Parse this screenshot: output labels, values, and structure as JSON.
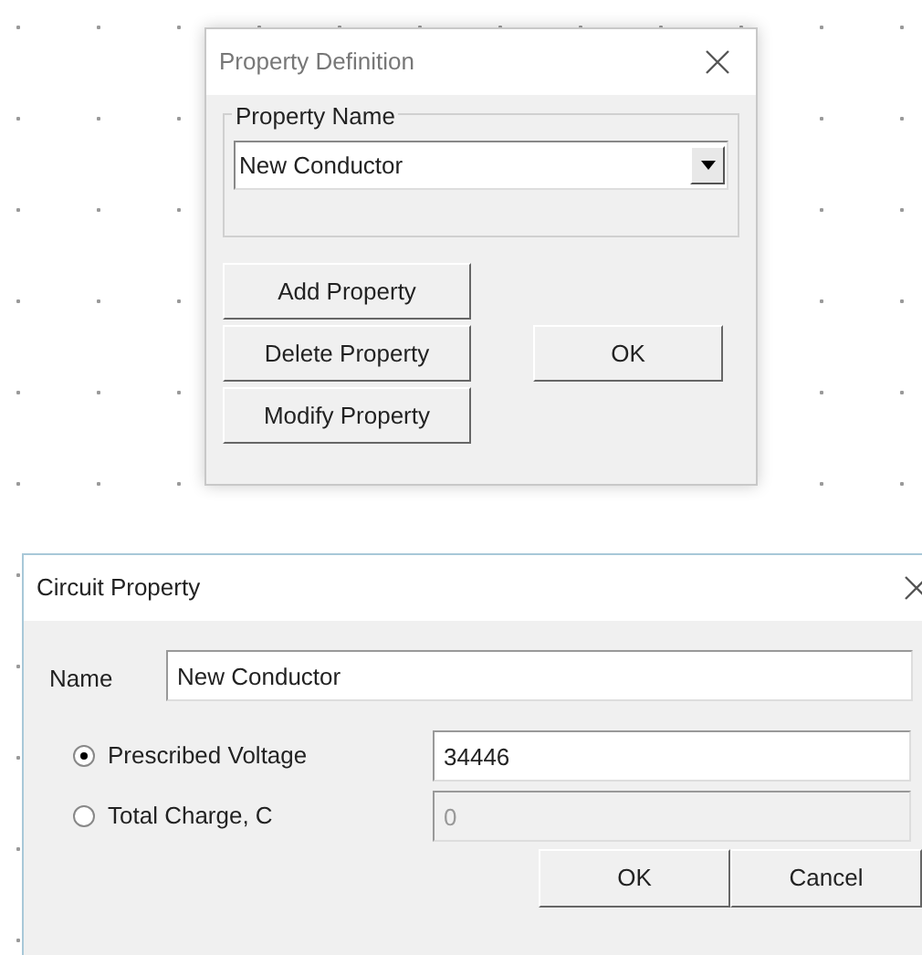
{
  "property_definition": {
    "title": "Property Definition",
    "group_label": "Property Name",
    "combo_value": "New Conductor",
    "buttons": [
      {
        "label": "Add Property"
      },
      {
        "label": "Delete Property"
      },
      {
        "label": "Modify Property"
      }
    ],
    "ok_button": "OK"
  },
  "circuit_property": {
    "title": "Circuit Property",
    "name_label": "Name",
    "name_value": "New Conductor",
    "options": [
      {
        "label": "Prescribed Voltage",
        "selected": true,
        "value": "34446",
        "disabled": false
      },
      {
        "label": "Total Charge, C",
        "selected": false,
        "value": "0",
        "disabled": true
      }
    ],
    "buttons": [
      "OK",
      "Cancel"
    ]
  }
}
